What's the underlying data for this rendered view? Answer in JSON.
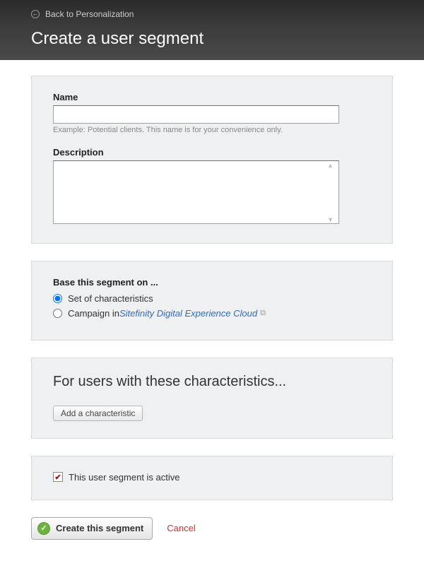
{
  "header": {
    "back_label": "Back to Personalization",
    "title": "Create a user segment"
  },
  "panel_name": {
    "name_label": "Name",
    "name_value": "",
    "name_hint": "Example: Potential clients. This name is for your convenience only.",
    "description_label": "Description",
    "description_value": ""
  },
  "panel_base": {
    "base_label": "Base this segment on ...",
    "option1": "Set of characteristics",
    "option2_prefix": "Campaign in ",
    "option2_link": "Sitefinity Digital Experience Cloud"
  },
  "panel_characteristics": {
    "heading": "For users with these characteristics...",
    "add_btn": "Add a characteristic"
  },
  "panel_active": {
    "label": "This user segment is active",
    "checked": true
  },
  "actions": {
    "create": "Create this segment",
    "cancel": "Cancel"
  }
}
